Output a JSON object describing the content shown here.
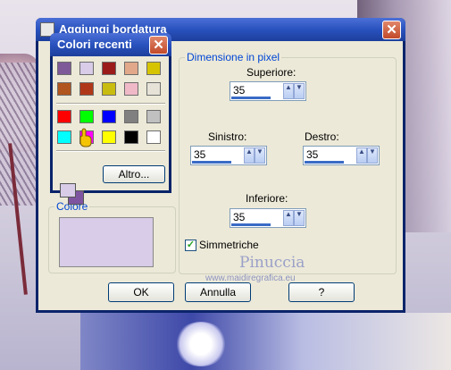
{
  "dialog": {
    "title": "Aggiungi bordatura",
    "close_glyph": "✕",
    "group_dimension_label": "Dimensione in pixel",
    "group_color_label": "Colore",
    "top_label": "Superiore:",
    "left_label": "Sinistro:",
    "right_label": "Destro:",
    "bottom_label": "Inferiore:",
    "top_value": "35",
    "left_value": "35",
    "right_value": "35",
    "bottom_value": "35",
    "symmetric_label": "Simmetriche",
    "symmetric_checked": true,
    "ok_label": "OK",
    "cancel_label": "Annulla",
    "help_label": "?",
    "border_color": "#d8cce8"
  },
  "recent_colors": {
    "title": "Colori recenti",
    "close_glyph": "✕",
    "more_label": "Altro...",
    "recent_row1": [
      "#7e5a98",
      "#d8cce8",
      "#9b1b1b",
      "#e1a889",
      "#d6c400"
    ],
    "recent_row2": [
      "#b0561e",
      "#b0381a",
      "#c9bc10",
      "#efb9c8",
      "#e6e2d8"
    ],
    "basic_row1": [
      "#ff0000",
      "#00ff00",
      "#0000ff",
      "#808080",
      "#c0c0c0"
    ],
    "basic_row2": [
      "#00ffff",
      "#ff00ff",
      "#ffff00",
      "#000000",
      "#ffffff"
    ],
    "foreground": "#d8cce8",
    "background": "#7e54a0"
  },
  "watermark": {
    "name": "Pinuccia",
    "url": "www.maidiregrafica.eu"
  }
}
